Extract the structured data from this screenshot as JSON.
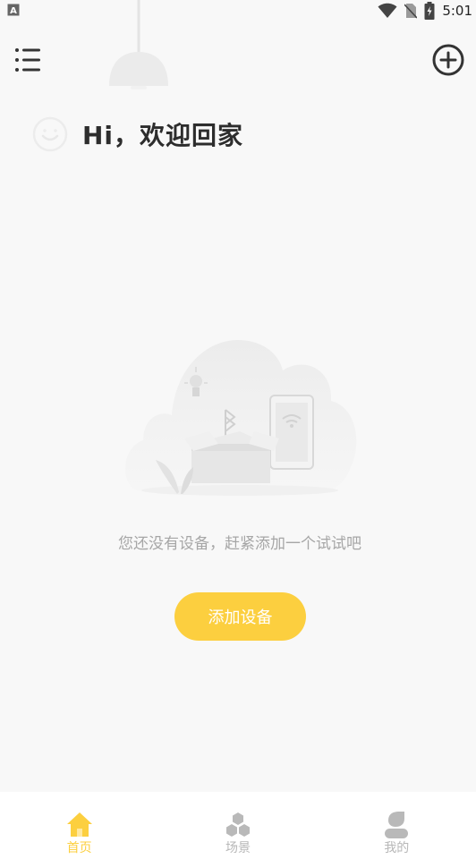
{
  "status_bar": {
    "time": "5:01"
  },
  "header": {
    "greeting": "Hi，欢迎回家"
  },
  "empty_state": {
    "message": "您还没有设备，赶紧添加一个试试吧",
    "button_label": "添加设备"
  },
  "tabs": [
    {
      "label": "首页",
      "icon": "home-icon",
      "active": true
    },
    {
      "label": "场景",
      "icon": "scene-icon",
      "active": false
    },
    {
      "label": "我的",
      "icon": "profile-icon",
      "active": false
    }
  ],
  "colors": {
    "accent": "#fccf3f",
    "background": "#f8f8f8",
    "inactive": "#b7b7b7"
  }
}
